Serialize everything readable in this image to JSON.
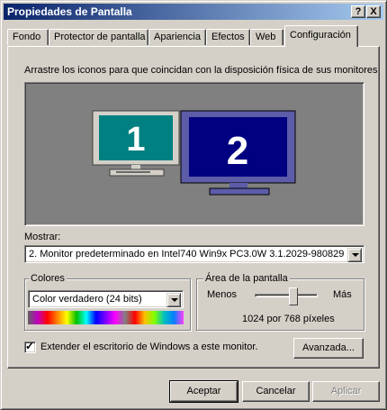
{
  "window": {
    "title": "Propiedades de Pantalla",
    "help_label": "?",
    "close_label": "X"
  },
  "tabs": [
    {
      "label": "Fondo"
    },
    {
      "label": "Protector de pantalla"
    },
    {
      "label": "Apariencia"
    },
    {
      "label": "Efectos"
    },
    {
      "label": "Web"
    },
    {
      "label": "Configuración"
    }
  ],
  "instructions": "Arrastre los iconos para que coincidan con la disposición física de sus monitores",
  "monitors": [
    {
      "number": "1",
      "screen_color": "#008080"
    },
    {
      "number": "2",
      "screen_color": "#000080"
    }
  ],
  "display": {
    "label": "Mostrar:",
    "value": "2. Monitor predeterminado en Intel740 Win9x PC3.0W 3.1.2029-980829"
  },
  "colors": {
    "group_label": "Colores",
    "value": "Color verdadero (24 bits)"
  },
  "screen_area": {
    "group_label": "Área de la pantalla",
    "less": "Menos",
    "more": "Más",
    "resolution": "1024 por 768 píxeles",
    "slider_level": 0.64
  },
  "extend": {
    "label": "Extender el escritorio de Windows a este monitor.",
    "checked": true
  },
  "advanced_label": "Avanzada...",
  "footer": {
    "ok": "Aceptar",
    "cancel": "Cancelar",
    "apply": "Aplicar"
  }
}
